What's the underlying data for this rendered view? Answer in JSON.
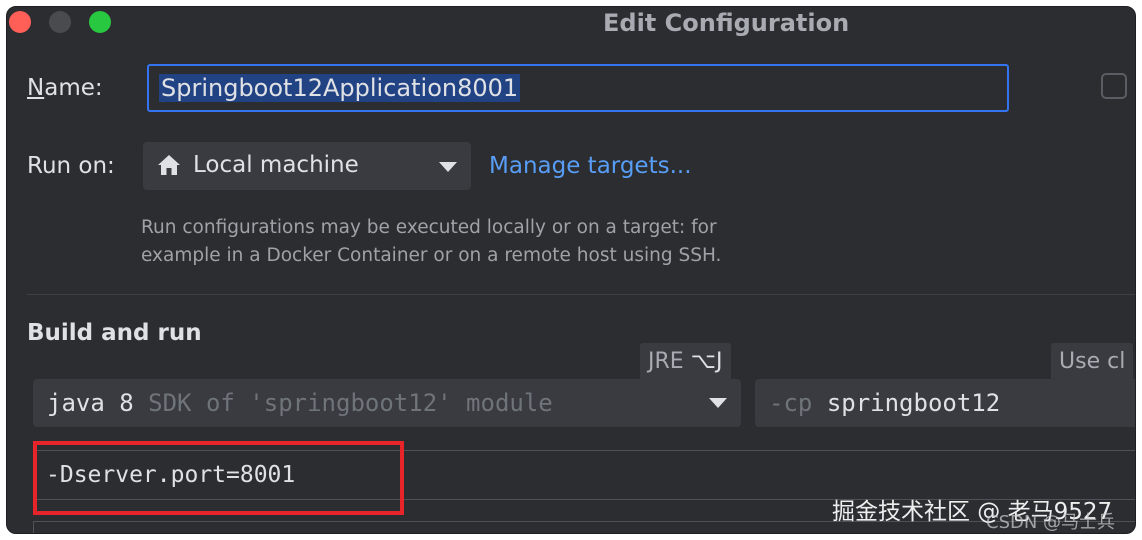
{
  "window": {
    "title": "Edit Configuration",
    "traffic_lights": {
      "close_color": "#ff5f57",
      "minimize_color": "#4a4b4e",
      "maximize_color": "#28c840"
    }
  },
  "form": {
    "name_label_mnemonic": "N",
    "name_label_rest": "ame:",
    "name_value": "Springboot12Application8001",
    "run_on_label": "Run on:",
    "run_on_icon": "home-icon",
    "run_on_value": "Local machine",
    "manage_targets_link": "Manage targets...",
    "help_line1": "Run configurations may be executed locally or on a target: for",
    "help_line2": "example in a Docker Container or on a remote host using SSH."
  },
  "build_and_run": {
    "title": "Build and run",
    "jre_hint_text": "JRE",
    "jre_hint_key": "⌥J",
    "use_classpath_hint": "Use cl",
    "sdk_java": "java 8",
    "sdk_detail": "SDK of 'springboot12' module",
    "cp_flag": "-cp",
    "cp_module": "springboot12",
    "vm_options": "-Dserver.port=8001"
  },
  "annotation": {
    "color": "#e8242b"
  },
  "watermark": {
    "main": "掘金技术社区 @ 老马9527",
    "sub": "CSDN @马士兵"
  },
  "colors": {
    "background": "#2b2d30",
    "accent_border": "#3574f0",
    "link": "#589df6",
    "selection": "#214283"
  }
}
